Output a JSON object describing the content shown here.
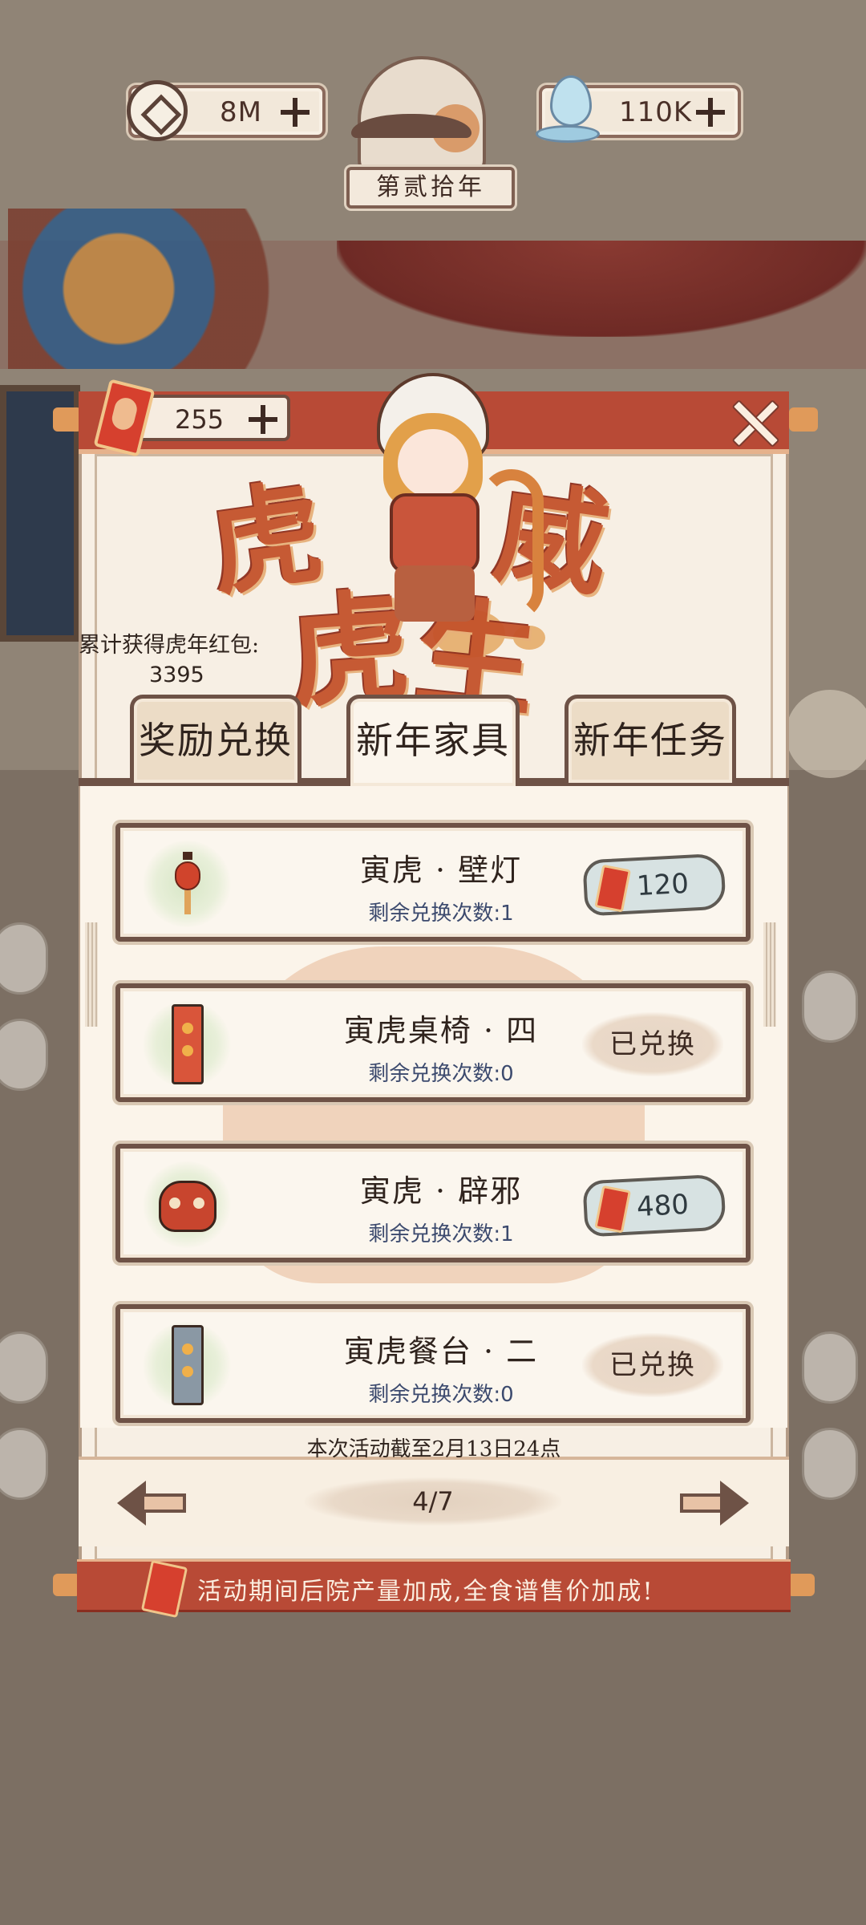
{
  "hud": {
    "coins": "8M",
    "water": "110K",
    "year_label": "第贰拾年"
  },
  "panel": {
    "red_packets": "255",
    "title_calligraphy": [
      "虎",
      "威",
      "虎",
      "生"
    ],
    "total_label": "累计获得虎年红包:",
    "total_value": "3395",
    "tabs": [
      {
        "label": "奖励兑换",
        "active": false
      },
      {
        "label": "新年家具",
        "active": true
      },
      {
        "label": "新年任务",
        "active": false
      }
    ],
    "items": [
      {
        "name": "寅虎 · 壁灯",
        "remaining": "剩余兑换次数:1",
        "status": "price",
        "price": "120",
        "icon": "lantern-icon"
      },
      {
        "name": "寅虎桌椅 · 四",
        "remaining": "剩余兑换次数:0",
        "status": "done",
        "done_label": "已兑换",
        "icon": "scroll-icon"
      },
      {
        "name": "寅虎 · 辟邪",
        "remaining": "剩余兑换次数:1",
        "status": "price",
        "price": "480",
        "icon": "tiger-mask-icon"
      },
      {
        "name": "寅虎餐台 · 二",
        "remaining": "剩余兑换次数:0",
        "status": "done",
        "done_label": "已兑换",
        "icon": "scroll-icon"
      }
    ],
    "deadline": "本次活动截至2月13日24点",
    "page": "4/7",
    "bonus_banner": "活动期间后院产量加成,全食谱售价加成!"
  },
  "colors": {
    "accent_red": "#b84a36",
    "panel_bg": "#f7efe4",
    "frame_brown": "#6e5246"
  }
}
